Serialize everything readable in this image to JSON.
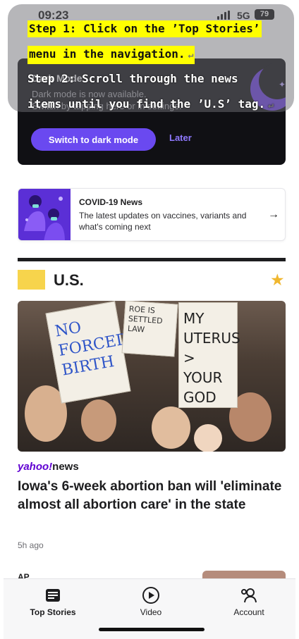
{
  "status_bar": {
    "time": "09:23",
    "network": "5G",
    "battery": "79"
  },
  "dark_mode_card": {
    "title": "Dark Mode",
    "subtitle_line1": "Dark mode is now available.",
    "subtitle_line2": "Switch by tapping here or in settings.",
    "switch_label": "Switch to dark mode",
    "later_label": "Later"
  },
  "covid_card": {
    "title": "COVID-19 News",
    "description": "The latest updates on vaccines, variants and what's coming next"
  },
  "section": {
    "title": "U.S."
  },
  "article": {
    "source": "yahoo!",
    "source_suffix": "news",
    "headline": "Iowa's 6-week abortion ban will 'eliminate almost all abortion care' in the state",
    "time_ago": "5h ago",
    "image_signs": [
      "NO FORCED BIRTH",
      "ROE IS SETTLED LAW",
      "MY UTERUS > YOUR GOD"
    ]
  },
  "next_article": {
    "source": "AP"
  },
  "tab_bar": {
    "tabs": [
      {
        "label": "Top Stories",
        "icon": "newspaper-icon",
        "active": true
      },
      {
        "label": "Video",
        "icon": "play-circle-icon",
        "active": false
      },
      {
        "label": "Account",
        "icon": "person-gear-icon",
        "active": false
      }
    ]
  },
  "instructions": {
    "step1_line1": "Step 1: Click on the ’Top Stories’",
    "step1_line2": "menu in the navigation.",
    "step2_line1": "Step 2: Scroll through the news",
    "step2_line2": "items until you find the ’U.S’ tag."
  },
  "colors": {
    "accent_purple": "#6a49f0",
    "section_yellow": "#f7d44c",
    "star_gold": "#f0b72f",
    "highlight_yellow": "#ffff00",
    "yahoo_purple": "#6001d2"
  }
}
